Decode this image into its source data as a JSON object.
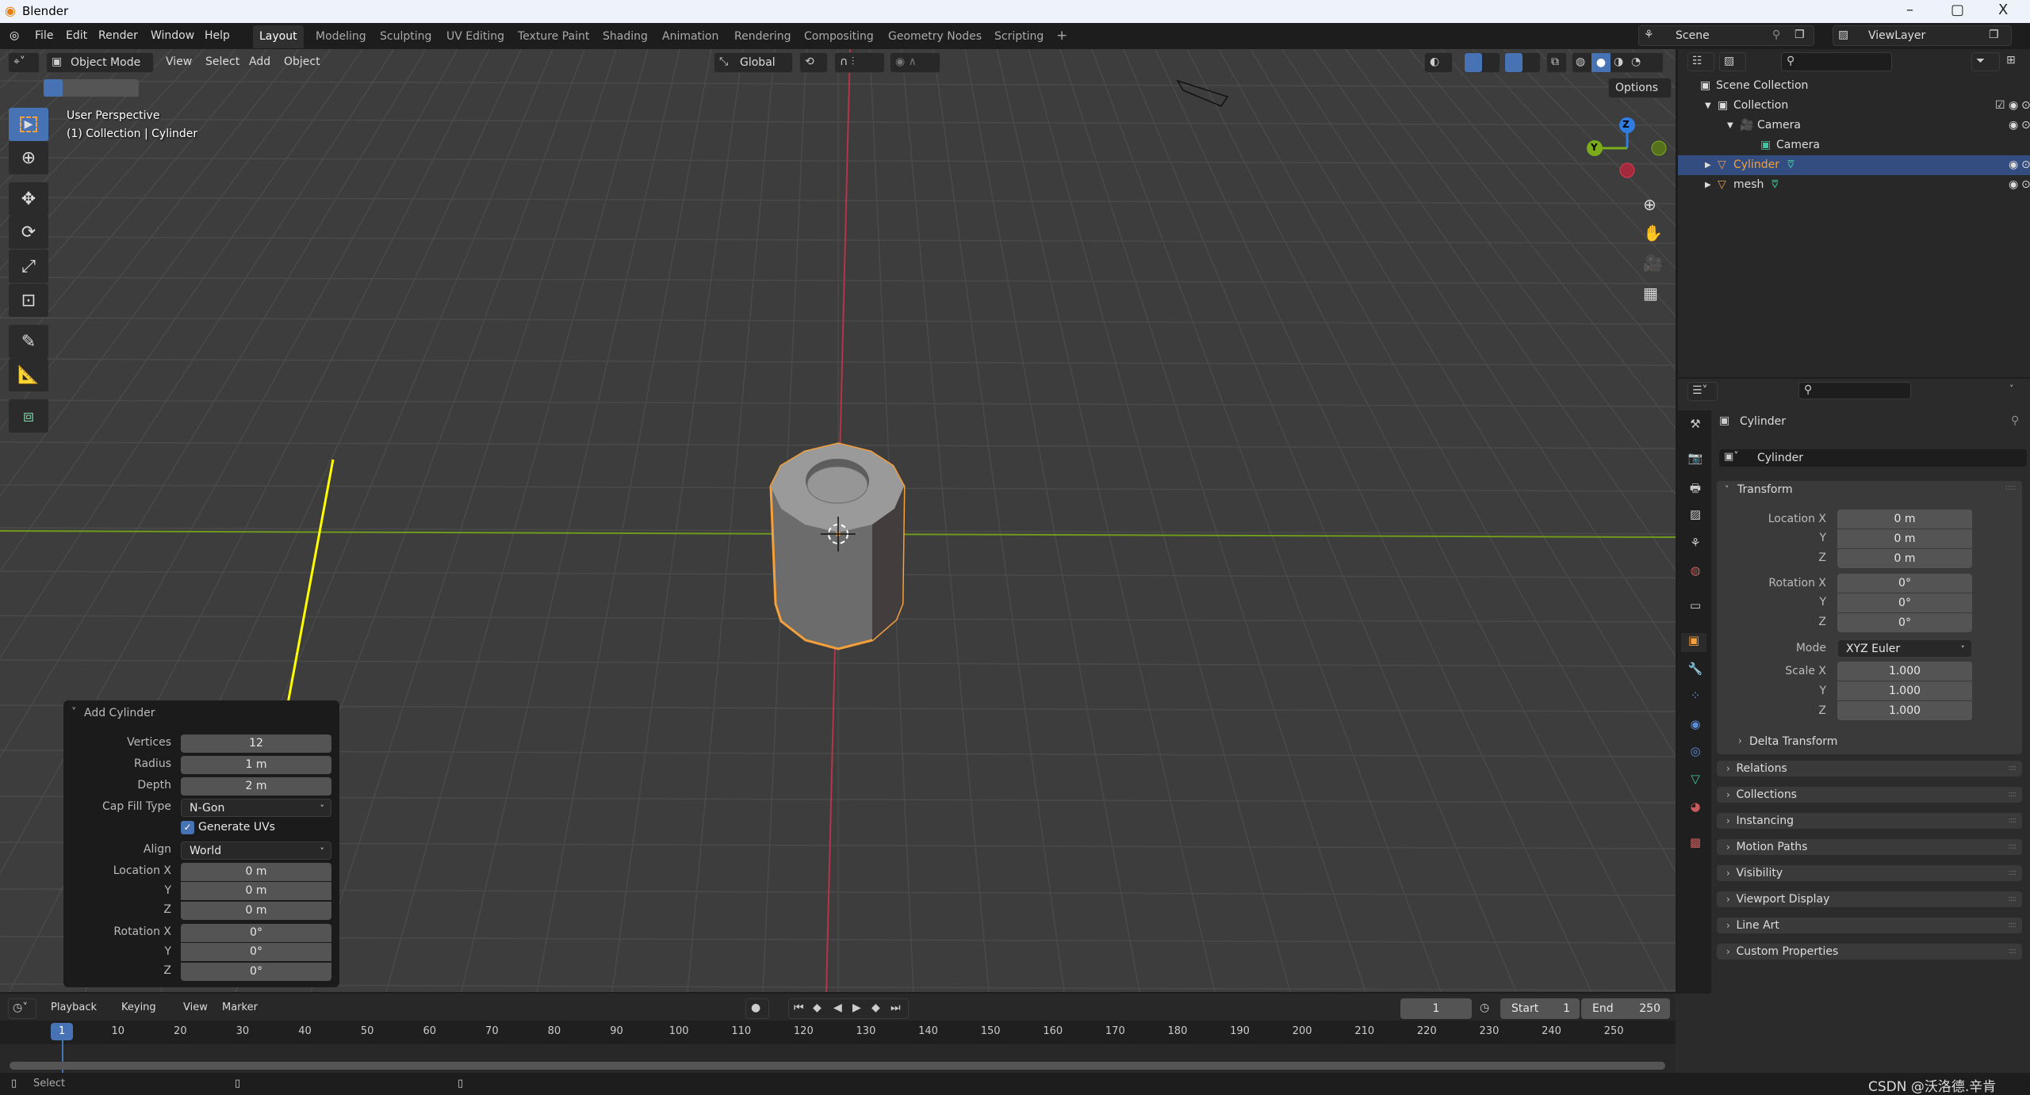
{
  "window": {
    "title": "Blender",
    "controls": [
      "–",
      "▢",
      "X"
    ]
  },
  "menu": [
    "File",
    "Edit",
    "Render",
    "Window",
    "Help"
  ],
  "workspaces": [
    {
      "label": "Layout",
      "active": true
    },
    {
      "label": "Modeling"
    },
    {
      "label": "Sculpting"
    },
    {
      "label": "UV Editing"
    },
    {
      "label": "Texture Paint"
    },
    {
      "label": "Shading"
    },
    {
      "label": "Animation"
    },
    {
      "label": "Rendering"
    },
    {
      "label": "Compositing"
    },
    {
      "label": "Geometry Nodes"
    },
    {
      "label": "Scripting"
    },
    {
      "label": "+"
    }
  ],
  "scene": {
    "name": "Scene",
    "view_layer": "ViewLayer"
  },
  "viewport": {
    "mode": "Object Mode",
    "menus": [
      "View",
      "Select",
      "Add",
      "Object"
    ],
    "orientation": "Global",
    "options": "Options",
    "overlay_line1": "User Perspective",
    "overlay_line2": "(1) Collection | Cylinder",
    "gizmo": {
      "z": "Z",
      "y": "Y"
    }
  },
  "tools": [
    "select-box",
    "cursor",
    "move",
    "rotate",
    "scale",
    "transform",
    "annotate",
    "measure",
    "add-cube"
  ],
  "add_cylinder": {
    "title": "Add Cylinder",
    "vertices_label": "Vertices",
    "vertices": "12",
    "radius_label": "Radius",
    "radius": "1 m",
    "depth_label": "Depth",
    "depth": "2 m",
    "cap_label": "Cap Fill Type",
    "cap": "N-Gon",
    "uv_label": "Generate UVs",
    "uv_checked": true,
    "align_label": "Align",
    "align": "World",
    "loc_label": "Location X",
    "loc": [
      "0 m",
      "0 m",
      "0 m"
    ],
    "rot_label": "Rotation X",
    "rot": [
      "0°",
      "0°",
      "0°"
    ],
    "y": "Y",
    "z": "Z"
  },
  "outliner": {
    "items": [
      {
        "label": "Scene Collection"
      },
      {
        "label": "Collection"
      },
      {
        "label": "Camera"
      },
      {
        "label": "Camera"
      },
      {
        "label": "Cylinder",
        "selected": true
      },
      {
        "label": "mesh"
      }
    ]
  },
  "properties": {
    "object_name": "Cylinder",
    "datablock": "Cylinder",
    "transform": "Transform",
    "location_label": "Location X",
    "location": [
      "0 m",
      "0 m",
      "0 m"
    ],
    "rotation_label": "Rotation X",
    "rotation": [
      "0°",
      "0°",
      "0°"
    ],
    "mode_label": "Mode",
    "mode": "XYZ Euler",
    "scale_label": "Scale X",
    "scale": [
      "1.000",
      "1.000",
      "1.000"
    ],
    "y": "Y",
    "z": "Z",
    "delta": "Delta Transform",
    "sections": [
      "Relations",
      "Collections",
      "Instancing",
      "Motion Paths",
      "Visibility",
      "Viewport Display",
      "Line Art",
      "Custom Properties"
    ]
  },
  "timeline": {
    "menus": [
      "Playback",
      "Keying",
      "View",
      "Marker"
    ],
    "current_frame": "1",
    "start_label": "Start",
    "start": "1",
    "end_label": "End",
    "end": "250",
    "ticks": [
      "10",
      "20",
      "30",
      "40",
      "50",
      "60",
      "70",
      "80",
      "90",
      "100",
      "110",
      "120",
      "130",
      "140",
      "150",
      "160",
      "170",
      "180",
      "190",
      "200",
      "210",
      "220",
      "230",
      "240",
      "250"
    ]
  },
  "status": {
    "select": "Select",
    "watermark": "CSDN @沃洛德.辛肯"
  },
  "colors": {
    "accent": "#4772b3",
    "selection": "#f5a03a",
    "x_axis": "#c23a4a",
    "y_axis": "#6f9a1e",
    "annotation_arrow": "#ffff00"
  }
}
